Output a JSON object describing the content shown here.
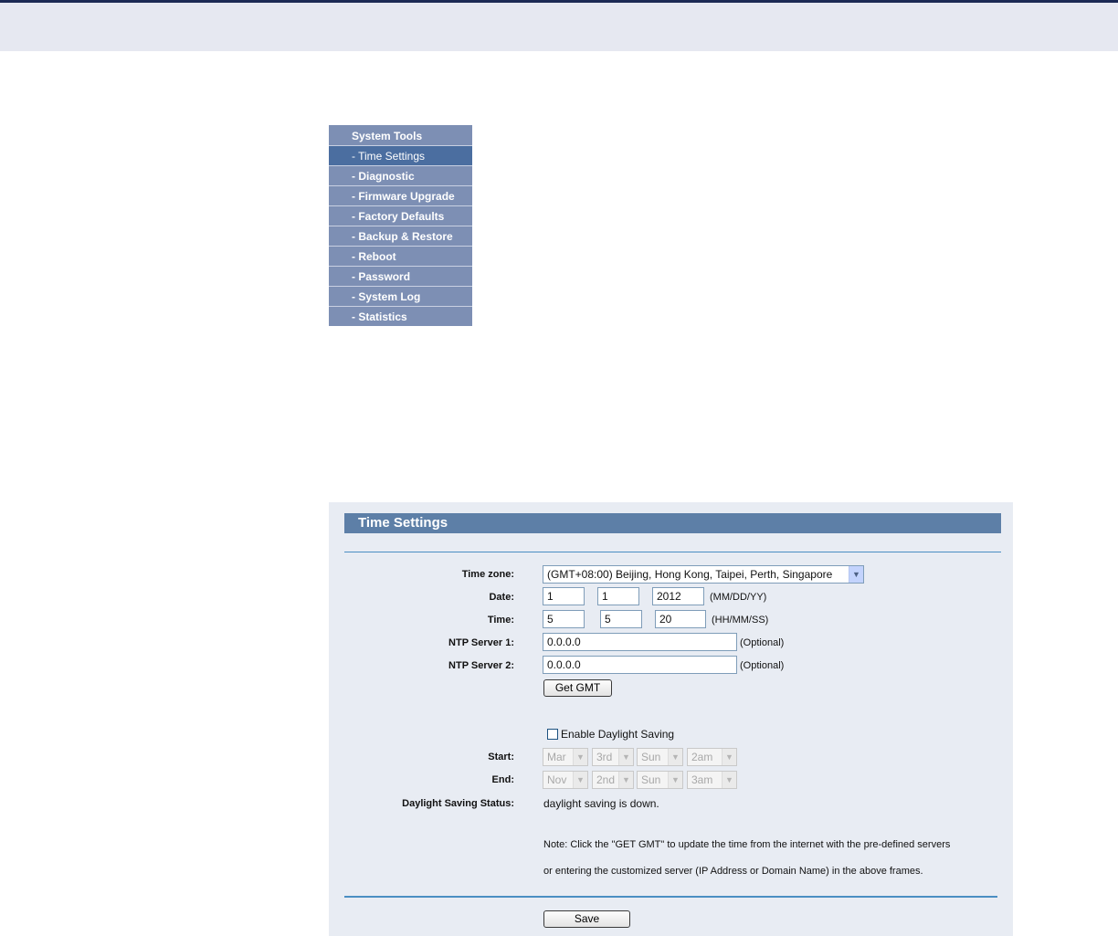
{
  "menu": {
    "header": "System Tools",
    "items": [
      "- Time Settings",
      "- Diagnostic",
      "- Firmware Upgrade",
      "- Factory Defaults",
      "- Backup & Restore",
      "- Reboot",
      "- Password",
      "- System Log",
      "- Statistics"
    ]
  },
  "panel": {
    "title": "Time Settings",
    "time_zone": {
      "label": "Time zone:",
      "value": "(GMT+08:00) Beijing, Hong Kong, Taipei, Perth, Singapore"
    },
    "date": {
      "label": "Date:",
      "month": "1",
      "day": "1",
      "year": "2012",
      "format": "(MM/DD/YY)"
    },
    "time": {
      "label": "Time:",
      "hour": "5",
      "minute": "5",
      "second": "20",
      "format": "(HH/MM/SS)"
    },
    "ntp1": {
      "label": "NTP Server 1:",
      "value": "0.0.0.0",
      "hint": "(Optional)"
    },
    "ntp2": {
      "label": "NTP Server 2:",
      "value": "0.0.0.0",
      "hint": "(Optional)"
    },
    "get_gmt_label": "Get GMT",
    "daylight": {
      "checkbox_label": "Enable Daylight Saving",
      "checked": false,
      "start_label": "Start:",
      "start": [
        "Mar",
        "3rd",
        "Sun",
        "2am"
      ],
      "end_label": "End:",
      "end": [
        "Nov",
        "2nd",
        "Sun",
        "3am"
      ],
      "status_label": "Daylight Saving Status:",
      "status_value": "daylight saving is down."
    },
    "note_line1": "Note: Click the \"GET GMT\" to update the time from the internet with the pre-defined servers",
    "note_line2": "or entering the customized server (IP Address or Domain Name) in the above frames.",
    "save_label": "Save"
  }
}
